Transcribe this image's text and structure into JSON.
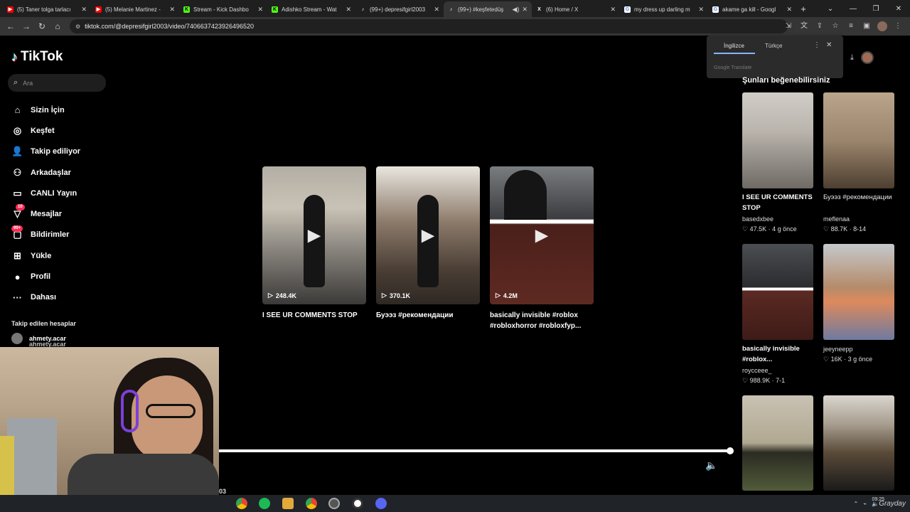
{
  "tabs": [
    {
      "title": "(5) Taner tolga tarlacı",
      "icon_color": "#ff0000"
    },
    {
      "title": "(5) Melanie Martinez -",
      "icon_color": "#ff0000"
    },
    {
      "title": "Stream - Kick Dashbo",
      "icon_color": "#53fc18"
    },
    {
      "title": "Adishko Stream - Wat",
      "icon_color": "#53fc18"
    },
    {
      "title": "(99+) depresifgirl2003",
      "icon_color": "#000000"
    },
    {
      "title": "(99+) #keşfetedüş",
      "icon_color": "#000000"
    },
    {
      "title": "(6) Home / X",
      "icon_color": "#000000"
    },
    {
      "title": "my dress up darling m",
      "icon_color": "#4285f4"
    },
    {
      "title": "akame ga kill - Googl",
      "icon_color": "#4285f4"
    }
  ],
  "address": {
    "url": "tiktok.com/@depresifgirl2003/video/7406637423926496520"
  },
  "brand": {
    "name": "TikTok"
  },
  "search": {
    "placeholder": "Ara"
  },
  "menu": [
    {
      "label": "Sizin İçin",
      "icon": "home-icon"
    },
    {
      "label": "Keşfet",
      "icon": "compass-icon"
    },
    {
      "label": "Takip ediliyor",
      "icon": "user-follow-icon"
    },
    {
      "label": "Arkadaşlar",
      "icon": "friends-icon"
    },
    {
      "label": "CANLI Yayın",
      "icon": "live-icon"
    },
    {
      "label": "Mesajlar",
      "icon": "message-icon",
      "badge": "10"
    },
    {
      "label": "Bildirimler",
      "icon": "inbox-icon",
      "badge": "99+"
    },
    {
      "label": "Yükle",
      "icon": "upload-icon"
    },
    {
      "label": "Profil",
      "icon": "profile-icon"
    },
    {
      "label": "Dahası",
      "icon": "more-icon"
    }
  ],
  "following": {
    "header": "Takip edilen hesaplar",
    "accounts": [
      {
        "name": "ahmety.acar",
        "handle": "ahmety.acar"
      }
    ]
  },
  "feed": [
    {
      "views": "248.4K",
      "title": "I SEE UR COMMENTS STOP"
    },
    {
      "views": "370.1K",
      "title": "Буээз #рекомендации"
    },
    {
      "views": "4.2M",
      "title": "basically invisible #roblox #robloxhorror #robloxfyp..."
    }
  ],
  "player": {
    "time_fragment": "03"
  },
  "translate_popup": {
    "source": "İngilizce",
    "target": "Türkçe",
    "footer": "Google Translate"
  },
  "related": {
    "header": "Şunları beğenebilirsiniz",
    "items": [
      {
        "title": "I SEE UR COMMENTS STOP",
        "author": "basedxbee",
        "likes": "47.5K",
        "date": "4 g önce"
      },
      {
        "title": "Буээз #рекомендации",
        "author": "meflenaa",
        "likes": "88.7K",
        "date": "8-14"
      },
      {
        "title": "basically invisible #roblox...",
        "author": "roycceee_",
        "likes": "988.9K",
        "date": "7-1"
      },
      {
        "title": "",
        "author": "jeeyneepp",
        "likes": "16K",
        "date": "3 g önce"
      },
      {
        "title": "",
        "author": "",
        "likes": "",
        "date": ""
      },
      {
        "title": "",
        "author": "",
        "likes": "",
        "date": ""
      }
    ]
  },
  "taskbar": {
    "time": "09:25",
    "watermark": "Grayday"
  }
}
